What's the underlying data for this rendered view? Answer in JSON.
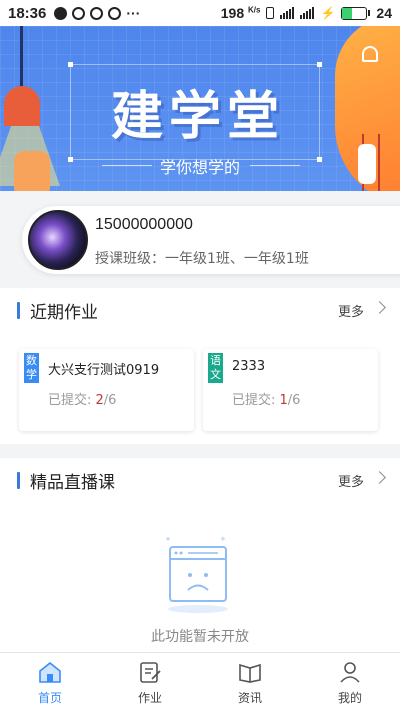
{
  "status_bar": {
    "time": "18:36",
    "speed": "198",
    "speed_unit": "K/s",
    "battery": "24"
  },
  "banner": {
    "title": "建学堂",
    "subtitle": "学你想学的"
  },
  "user": {
    "phone": "15000000000",
    "classes": "授课班级：一年级1班、一年级1班"
  },
  "homework": {
    "title": "近期作业",
    "more": "更多",
    "items": [
      {
        "subject": "数学",
        "subject_color": "#3a8cf5",
        "name": "大兴支行测试0919",
        "status_label": "已提交: ",
        "submitted": "2",
        "total": "/6"
      },
      {
        "subject": "语文",
        "subject_color": "#1aa98c",
        "name": "2333",
        "status_label": "已提交: ",
        "submitted": "1",
        "total": "/6"
      }
    ]
  },
  "live": {
    "title": "精品直播课",
    "more": "更多",
    "empty_text": "此功能暂未开放"
  },
  "tabs": [
    {
      "label": "首页",
      "icon": "home-icon",
      "active": true
    },
    {
      "label": "作业",
      "icon": "homework-icon",
      "active": false
    },
    {
      "label": "资讯",
      "icon": "news-icon",
      "active": false
    },
    {
      "label": "我的",
      "icon": "profile-icon",
      "active": false
    }
  ],
  "colors": {
    "accent": "#3a8cf5",
    "banner": "#4f86ec",
    "highlight": "#c0392b"
  }
}
